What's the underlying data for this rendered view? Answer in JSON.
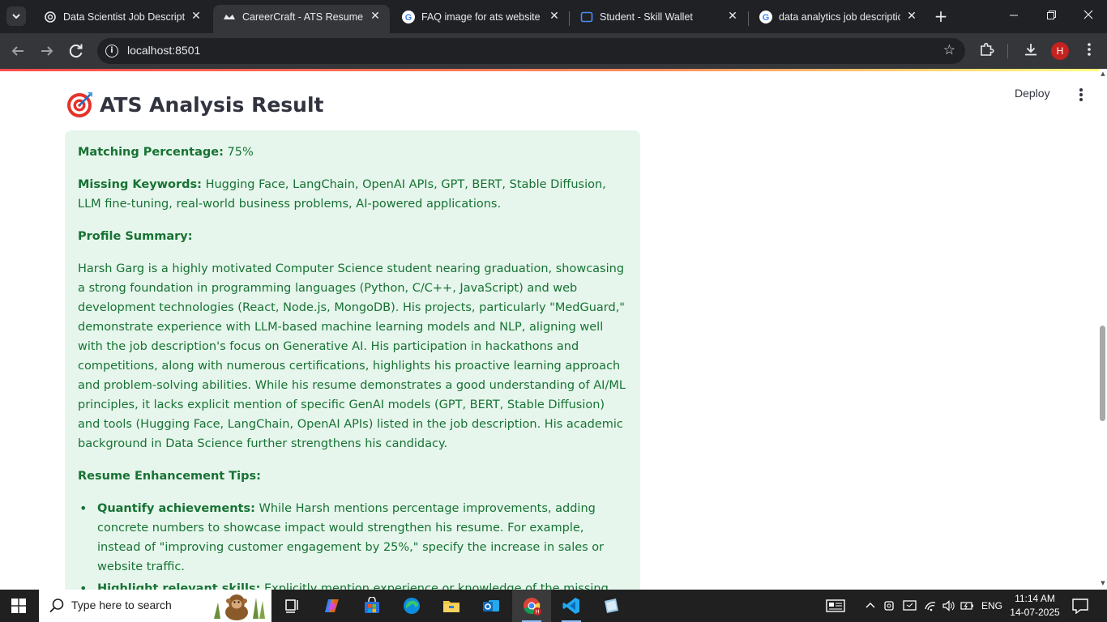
{
  "browser": {
    "tabs": [
      {
        "title": "Data Scientist Job Descriptio",
        "icon": "openai-icon"
      },
      {
        "title": "CareerCraft - ATS Resume Ar",
        "icon": "streamlit-crown-icon",
        "active": true
      },
      {
        "title": "FAQ image for ats website -",
        "icon": "google-icon"
      },
      {
        "title": "Student - Skill Wallet",
        "icon": "skill-wallet-icon"
      },
      {
        "title": "data analytics job descriptio",
        "icon": "google-icon"
      }
    ],
    "url": "localhost:8501",
    "profile_initial": "H"
  },
  "page": {
    "deploy_label": "Deploy",
    "title": "ATS Analysis Result",
    "result": {
      "matching_label": "Matching Percentage:",
      "matching_value": "75%",
      "missing_label": "Missing Keywords:",
      "missing_value": "Hugging Face, LangChain, OpenAI APIs, GPT, BERT, Stable Diffusion, LLM fine-tuning, real-world business problems, AI-powered applications.",
      "summary_label": "Profile Summary:",
      "summary_text": "Harsh Garg is a highly motivated Computer Science student nearing graduation, showcasing a strong foundation in programming languages (Python, C/C++, JavaScript) and web development technologies (React, Node.js, MongoDB). His projects, particularly \"MedGuard,\" demonstrate experience with LLM-based machine learning models and NLP, aligning well with the job description's focus on Generative AI. His participation in hackathons and competitions, along with numerous certifications, highlights his proactive learning approach and problem-solving abilities. While his resume demonstrates a good understanding of AI/ML principles, it lacks explicit mention of specific GenAI models (GPT, BERT, Stable Diffusion) and tools (Hugging Face, LangChain, OpenAI APIs) listed in the job description. His academic background in Data Science further strengthens his candidacy.",
      "tips_label": "Resume Enhancement Tips:",
      "tips": [
        {
          "title": "Quantify achievements:",
          "text": "While Harsh mentions percentage improvements, adding concrete numbers to showcase impact would strengthen his resume. For example, instead of \"improving customer engagement by 25%,\" specify the increase in sales or website traffic."
        },
        {
          "title": "Highlight relevant skills:",
          "text": "Explicitly mention experience or knowledge of the missing keywords. Even brief mentions of exposure to Hugging Face or LangChain through personal projects or online courses would significantly boost his score."
        }
      ]
    }
  },
  "taskbar": {
    "search_placeholder": "Type here to search",
    "language": "ENG",
    "time": "11:14 AM",
    "date": "14-07-2025"
  }
}
